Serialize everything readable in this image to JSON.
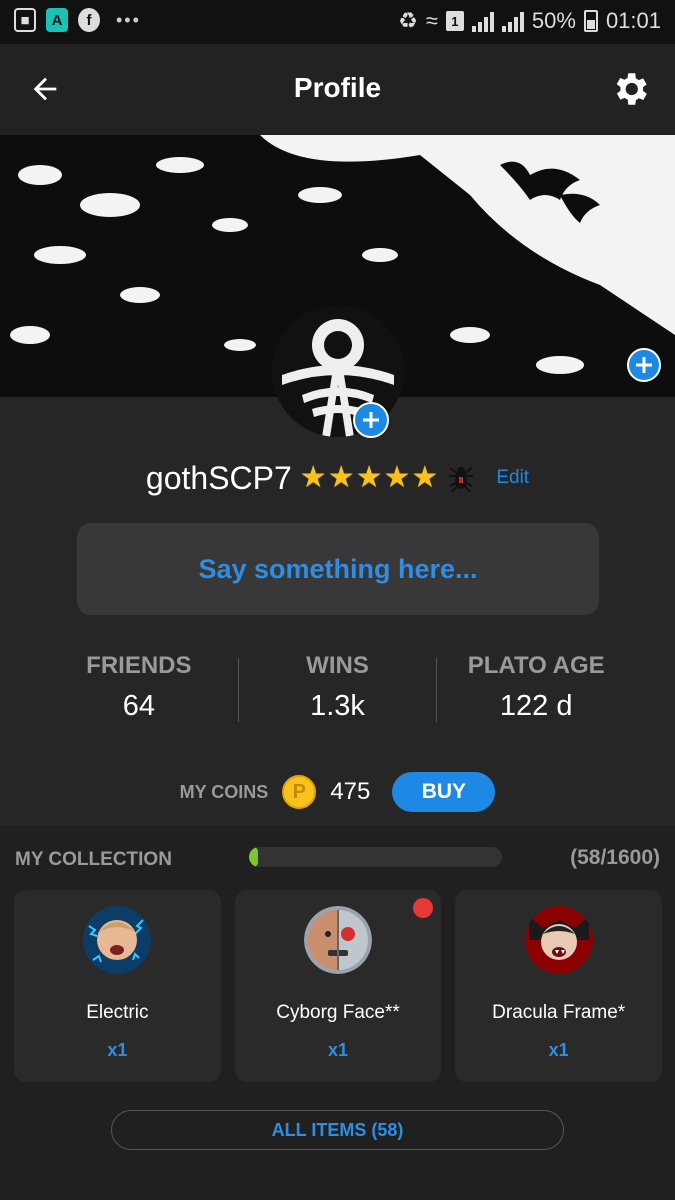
{
  "status_bar": {
    "battery": "50%",
    "time": "01:01",
    "sim_slot": "1",
    "app_icon_letter": "A",
    "fb_letter": "f",
    "overflow": "•••"
  },
  "header": {
    "title": "Profile"
  },
  "profile": {
    "username": "gothSCP7",
    "star_count": 5,
    "edit_label": "Edit",
    "bio_placeholder": "Say something here..."
  },
  "stats": [
    {
      "label": "FRIENDS",
      "value": "64"
    },
    {
      "label": "WINS",
      "value": "1.3k"
    },
    {
      "label": "PLATO AGE",
      "value": "122 d"
    }
  ],
  "coins": {
    "label": "MY COINS",
    "coin_symbol": "P",
    "value": "475",
    "buy_label": "BUY"
  },
  "collection": {
    "title": "MY COLLECTION",
    "count": "(58/1600)",
    "progress_fraction": 0.036,
    "items": [
      {
        "name": "Electric",
        "qty": "x1",
        "is_new": false
      },
      {
        "name": "Cyborg Face**",
        "qty": "x1",
        "is_new": true
      },
      {
        "name": "Dracula Frame*",
        "qty": "x1",
        "is_new": false
      }
    ],
    "all_items_label": "ALL ITEMS (58)"
  },
  "colors": {
    "accent_blue": "#1e88e5",
    "star_gold": "#f7c21e",
    "progress_green": "#7ac62f",
    "new_badge_red": "#e53935"
  }
}
